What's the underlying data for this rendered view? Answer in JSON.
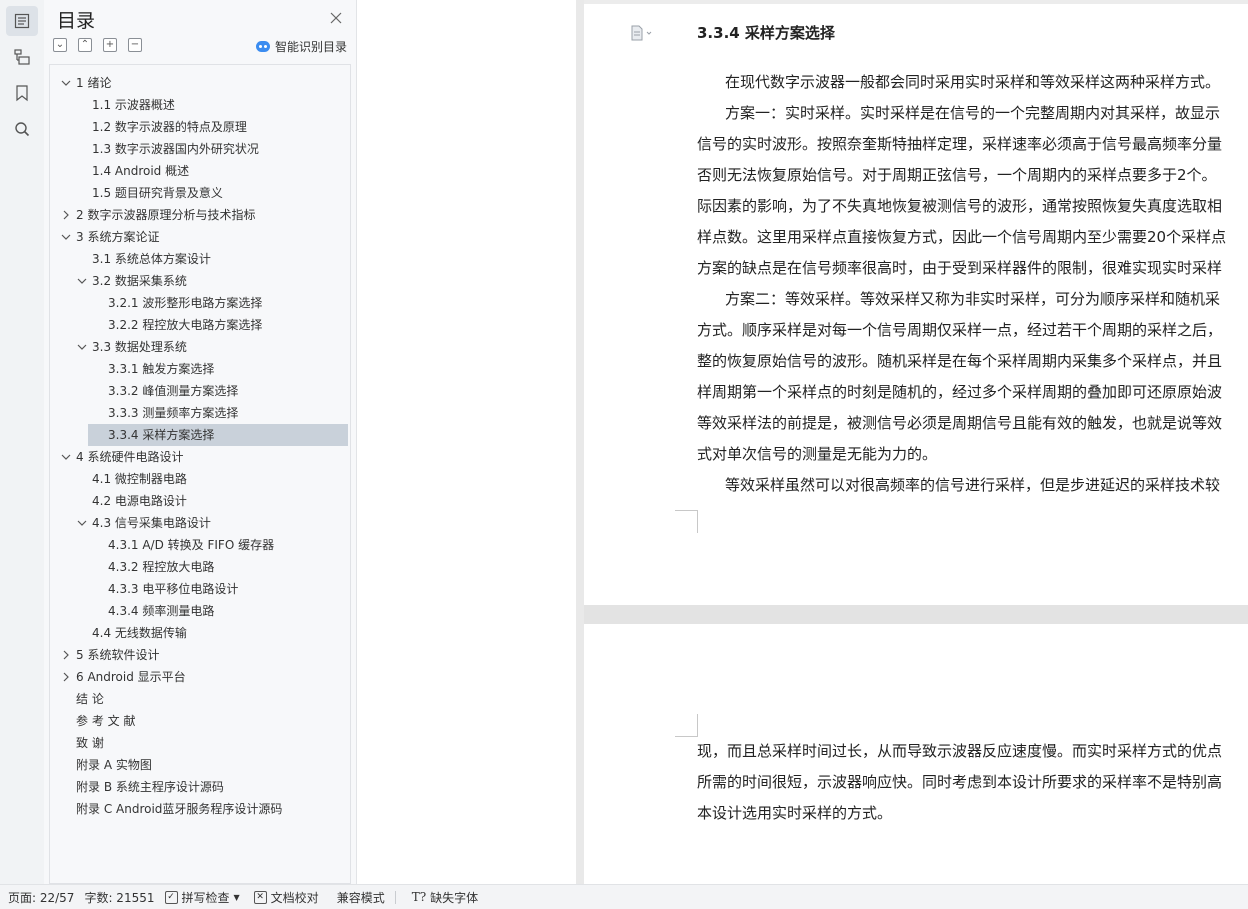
{
  "toc": {
    "title": "目录",
    "smart_label": "智能识别目录",
    "tools": [
      "⌄",
      "⌃",
      "+",
      "−"
    ],
    "items": [
      {
        "text": "1  绪论",
        "level": 1,
        "caret": "down"
      },
      {
        "text": "1.1  示波器概述",
        "level": 2
      },
      {
        "text": "1.2  数字示波器的特点及原理",
        "level": 2
      },
      {
        "text": "1.3  数字示波器国内外研究状况",
        "level": 2
      },
      {
        "text": "1.4 Android 概述",
        "level": 2
      },
      {
        "text": "1.5  题目研究背景及意义",
        "level": 2
      },
      {
        "text": "2  数字示波器原理分析与技术指标",
        "level": 1,
        "caret": "right"
      },
      {
        "text": "3  系统方案论证",
        "level": 1,
        "caret": "down"
      },
      {
        "text": "3.1  系统总体方案设计",
        "level": 2
      },
      {
        "text": "3.2  数据采集系统",
        "level": 2,
        "caret": "down"
      },
      {
        "text": "3.2.1  波形整形电路方案选择",
        "level": 3
      },
      {
        "text": "3.2.2  程控放大电路方案选择",
        "level": 3
      },
      {
        "text": "3.3  数据处理系统",
        "level": 2,
        "caret": "down"
      },
      {
        "text": "3.3.1  触发方案选择",
        "level": 3
      },
      {
        "text": "3.3.2  峰值测量方案选择",
        "level": 3
      },
      {
        "text": "3.3.3  测量频率方案选择",
        "level": 3
      },
      {
        "text": "3.3.4  采样方案选择",
        "level": 3,
        "selected": true
      },
      {
        "text": "4  系统硬件电路设计",
        "level": 1,
        "caret": "down"
      },
      {
        "text": "4.1  微控制器电路",
        "level": 2
      },
      {
        "text": "4.2  电源电路设计",
        "level": 2
      },
      {
        "text": "4.3  信号采集电路设计",
        "level": 2,
        "caret": "down"
      },
      {
        "text": "4.3.1 A/D 转换及 FIFO 缓存器",
        "level": 3
      },
      {
        "text": "4.3.2  程控放大电路",
        "level": 3
      },
      {
        "text": "4.3.3  电平移位电路设计",
        "level": 3
      },
      {
        "text": "4.3.4  频率测量电路",
        "level": 3
      },
      {
        "text": "4.4  无线数据传输",
        "level": 2
      },
      {
        "text": "5  系统软件设计",
        "level": 1,
        "caret": "right"
      },
      {
        "text": "6 Android 显示平台",
        "level": 1,
        "caret": "right"
      },
      {
        "text": "结    论",
        "level": 1
      },
      {
        "text": "参    考    文    献",
        "level": 1
      },
      {
        "text": "致    谢",
        "level": 1
      },
      {
        "text": "附录  A    实物图",
        "level": 1
      },
      {
        "text": "附录  B    系统主程序设计源码",
        "level": 1
      },
      {
        "text": "附录  C    Android蓝牙服务程序设计源码",
        "level": 1
      }
    ]
  },
  "document": {
    "heading": "3.3.4  采样方案选择",
    "page1_lines": [
      "在现代数字示波器一般都会同时采用实时采样和等效采样这两种采样方式。",
      "方案一：实时采样。实时采样是在信号的一个完整周期内对其采样，故显示",
      "信号的实时波形。按照奈奎斯特抽样定理，采样速率必须高于信号最高频率分量",
      "否则无法恢复原始信号。对于周期正弦信号，一个周期内的采样点要多于2个。",
      "际因素的影响，为了不失真地恢复被测信号的波形，通常按照恢复失真度选取相",
      "样点数。这里用采样点直接恢复方式，因此一个信号周期内至少需要20个采样点",
      "方案的缺点是在信号频率很高时，由于受到采样器件的限制，很难实现实时采样",
      "方案二：等效采样。等效采样又称为非实时采样，可分为顺序采样和随机采",
      "方式。顺序采样是对每一个信号周期仅采样一点，经过若干个周期的采样之后，",
      "整的恢复原始信号的波形。随机采样是在每个采样周期内采集多个采样点，并且",
      "样周期第一个采样点的时刻是随机的，经过多个采样周期的叠加即可还原原始波",
      "等效采样法的前提是，被测信号必须是周期信号且能有效的触发，也就是说等效",
      "式对单次信号的测量是无能为力的。",
      "等效采样虽然可以对很高频率的信号进行采样，但是步进延迟的采样技术较"
    ],
    "page1_indent": [
      true,
      true,
      false,
      false,
      false,
      false,
      false,
      true,
      false,
      false,
      false,
      false,
      false,
      true
    ],
    "page2_lines": [
      "现，而且总采样时间过长，从而导致示波器反应速度慢。而实时采样方式的优点",
      "所需的时间很短，示波器响应快。同时考虑到本设计所要求的采样率不是特别高",
      "本设计选用实时采样的方式。"
    ]
  },
  "status": {
    "page": "页面: 22/57",
    "words": "字数: 21551",
    "spell": "拼写检查",
    "proof": "文档校对",
    "compat": "兼容模式",
    "font_missing": "缺失字体"
  }
}
